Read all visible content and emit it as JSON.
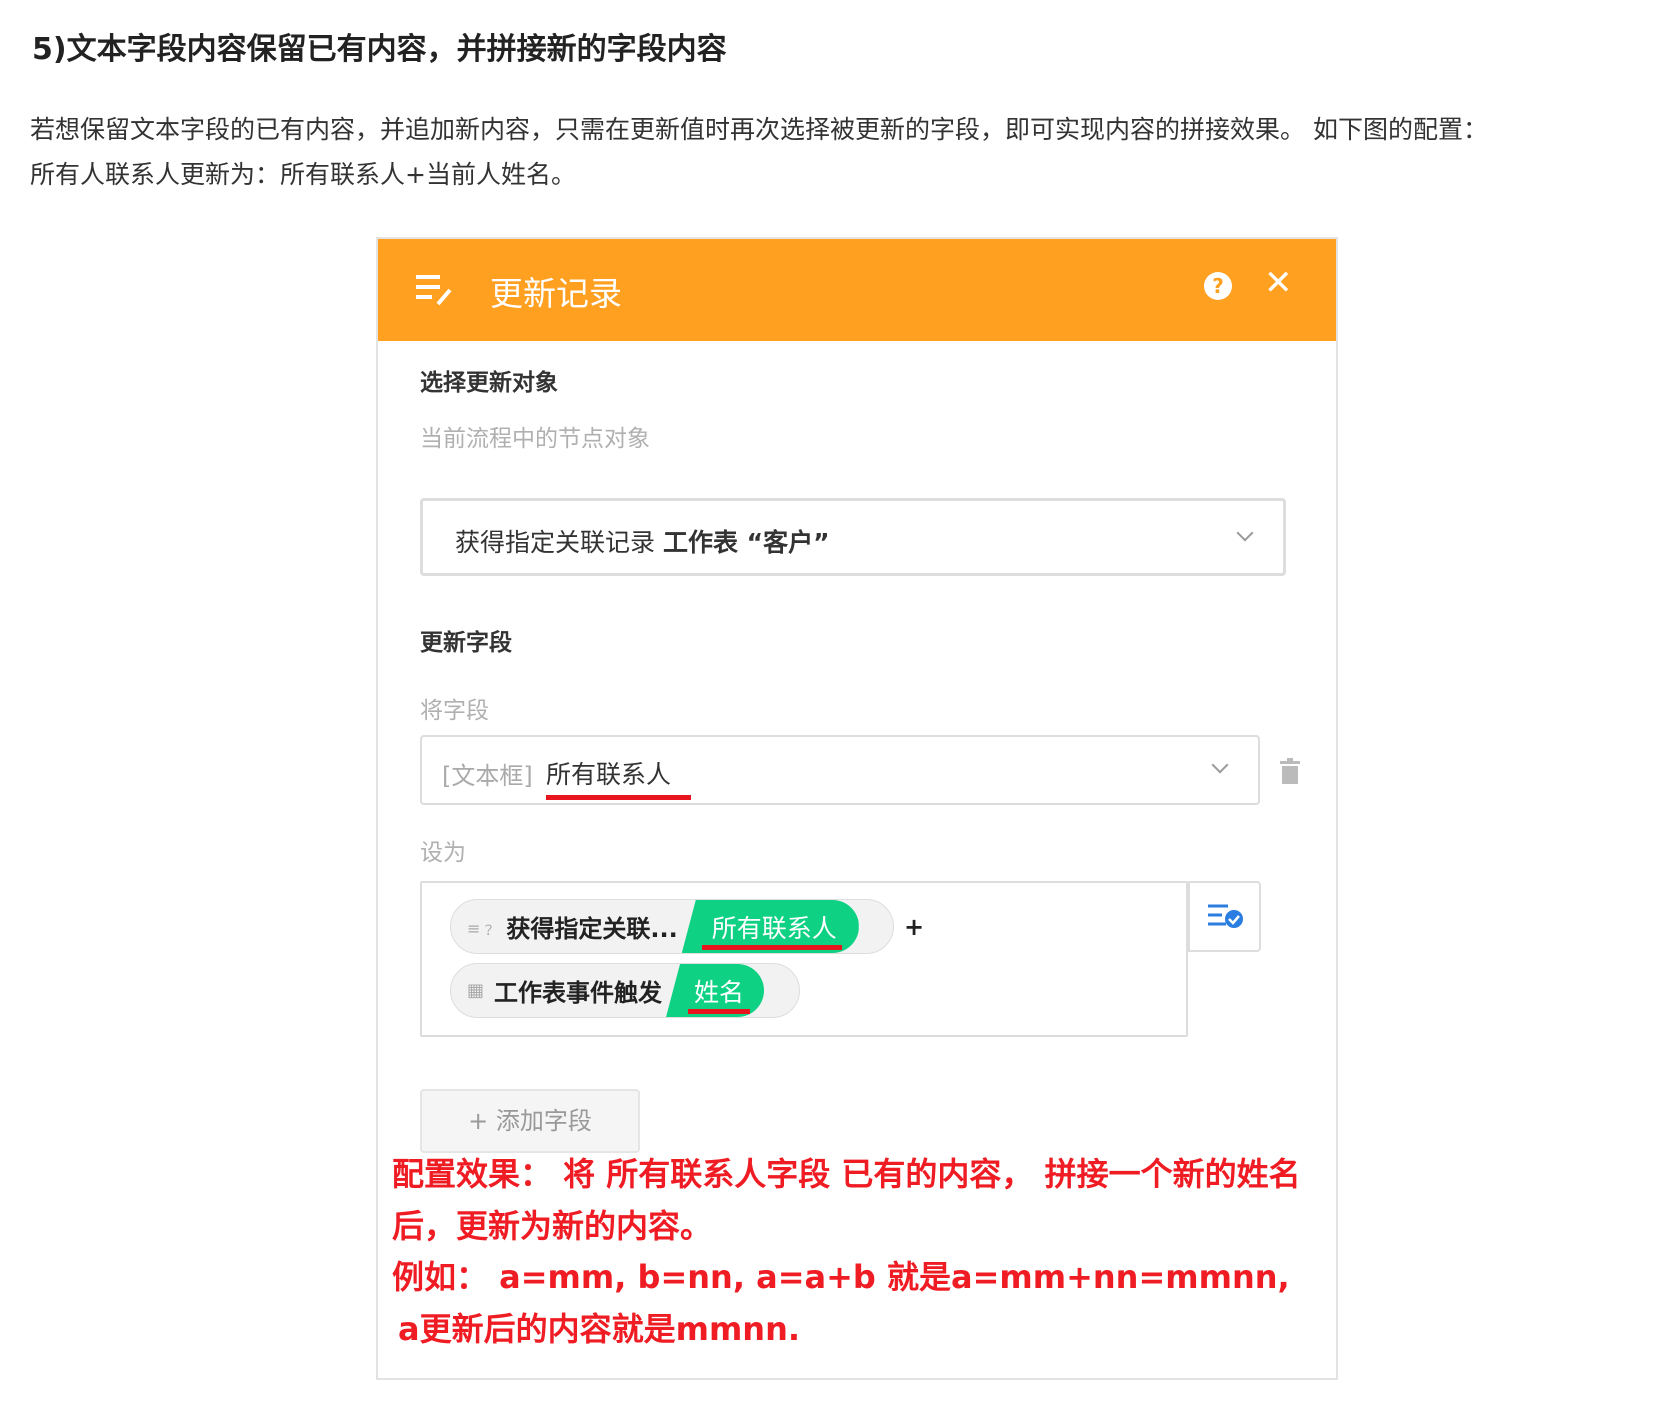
{
  "heading": "5)文本字段内容保留已有内容，并拼接新的字段内容",
  "paragraph": [
    "若想保留文本字段的已有内容，并追加新内容，只需在更新值时再次选择被更新的字段，即可实现内容的拼接效果。 如下图的配置：",
    "所有人联系人更新为：所有联系人+当前人姓名。"
  ],
  "dialog": {
    "title": "更新记录",
    "header_color": "#ffa020",
    "select_object_label": "选择更新对象",
    "select_object_hint": "当前流程中的节点对象",
    "select_object_value_a": "获得指定关联记录",
    "select_object_value_b": "工作表 “客户”",
    "update_field_label": "更新字段",
    "field_label": "将字段",
    "field_type": "[文本框]",
    "field_value": "所有联系人",
    "set_to_label": "设为",
    "tags": [
      {
        "node": "获得指定关联...",
        "field": "所有联系人"
      },
      {
        "node": "工作表事件触发",
        "field": "姓名"
      }
    ],
    "plus": "+",
    "add_field": "+ 添加字段",
    "tag_color": "#0fd184"
  },
  "annotation": [
    "配置效果： 将 所有联系人字段 已有的内容， 拼接一个新的姓名",
    "后，更新为新的内容。",
    "例如： a=mm, b=nn, a=a+b  就是a=mm+nn=mmnn,",
    "a更新后的内容就是mmnn."
  ],
  "annotation_color": "#ef1c24"
}
